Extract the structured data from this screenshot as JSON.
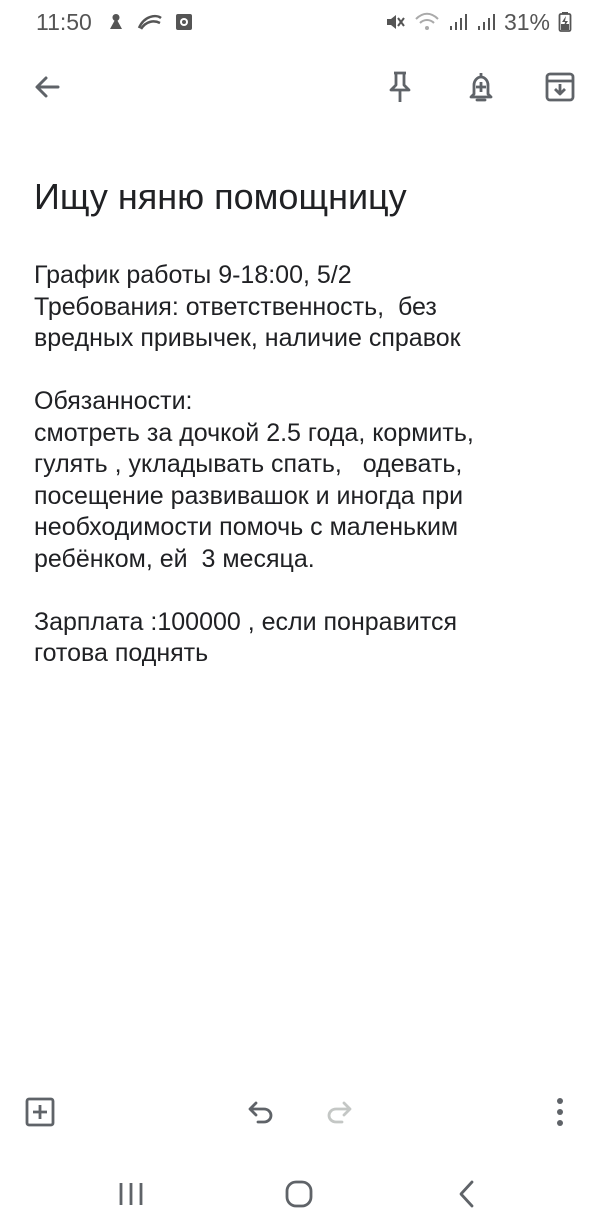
{
  "status_bar": {
    "time": "11:50",
    "battery_percent": "31%",
    "icons": [
      "notification-icon",
      "app-icon",
      "screen-record-icon",
      "mute-icon",
      "wifi-icon",
      "signal-icon",
      "signal-icon",
      "battery-charging-icon"
    ]
  },
  "app_bar": {
    "icons": [
      "back-arrow-icon",
      "pin-icon",
      "reminder-bell-icon",
      "archive-icon"
    ]
  },
  "note": {
    "title": "Ищу няню помощницу",
    "lines": [
      "График работы 9-18:00, 5/2",
      "Требования: ответственность,  без",
      "вредных привычек, наличие справок",
      "",
      "Обязанности:",
      "смотреть за дочкой 2.5 года, кормить,",
      "гулять , укладывать спать,   одевать,",
      "посещение развивашок и иногда при",
      "необходимости помочь с маленьким",
      "ребёнком, ей  3 месяца.",
      "",
      "Зарплата :100000 , если понравится",
      "готова поднять"
    ]
  },
  "bottom_toolbar": {
    "icons": [
      "add-box-icon",
      "undo-icon",
      "redo-icon",
      "more-vert-icon"
    ],
    "redo_enabled": false
  },
  "nav_bar": {
    "icons": [
      "recents-icon",
      "home-icon",
      "back-chevron-icon"
    ]
  },
  "colors": {
    "background": "#ffffff",
    "text": "#202124",
    "icon": "#5f6368",
    "icon_disabled": "#c4c7c5"
  }
}
